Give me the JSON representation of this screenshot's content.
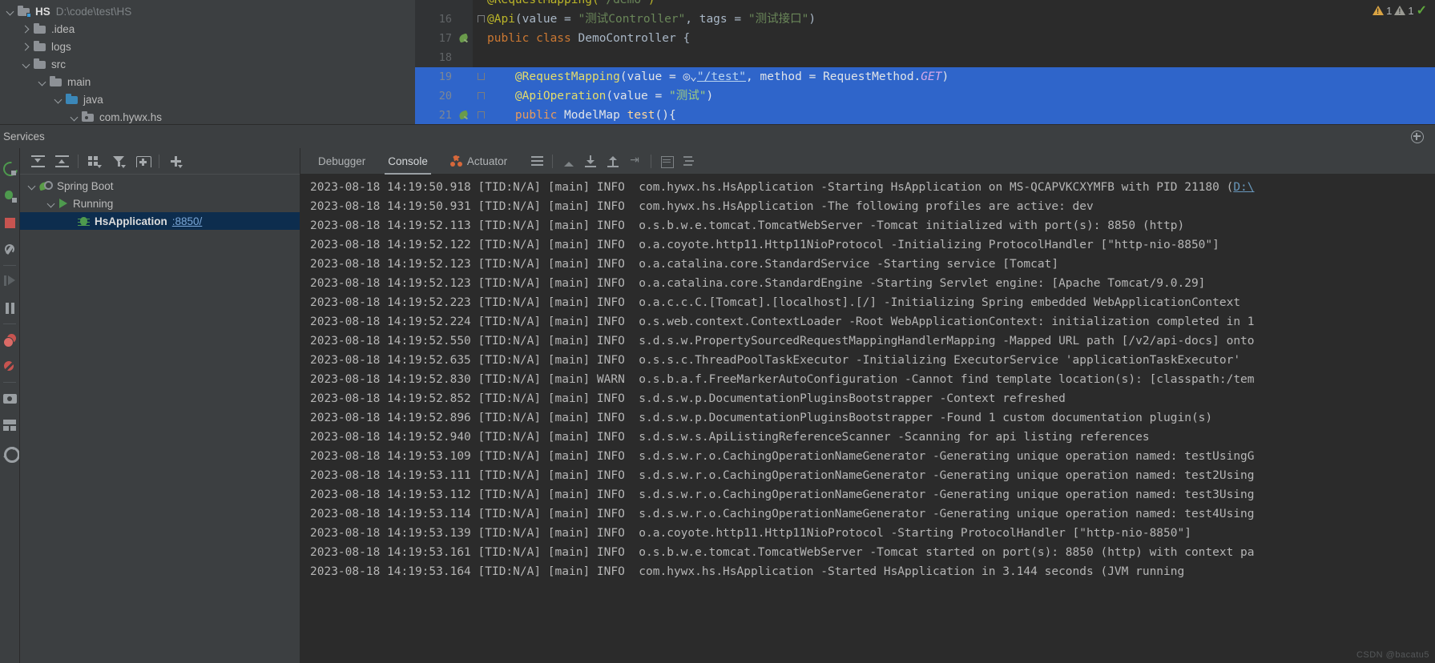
{
  "project_tree": [
    {
      "indent": 0,
      "chevron": "down",
      "icon": "project-folder-icon",
      "label": "HS",
      "bold": true,
      "path": "D:\\code\\test\\HS"
    },
    {
      "indent": 1,
      "chevron": "right",
      "icon": "folder-icon",
      "label": ".idea",
      "bold": false,
      "path": ""
    },
    {
      "indent": 1,
      "chevron": "right",
      "icon": "folder-icon",
      "label": "logs",
      "bold": false,
      "path": ""
    },
    {
      "indent": 1,
      "chevron": "down",
      "icon": "folder-icon",
      "label": "src",
      "bold": false,
      "path": ""
    },
    {
      "indent": 2,
      "chevron": "down",
      "icon": "folder-icon",
      "label": "main",
      "bold": false,
      "path": ""
    },
    {
      "indent": 3,
      "chevron": "down",
      "icon": "folder-blue-icon",
      "label": "java",
      "bold": false,
      "path": ""
    },
    {
      "indent": 4,
      "chevron": "down",
      "icon": "package-icon",
      "label": "com.hywx.hs",
      "bold": false,
      "path": ""
    }
  ],
  "editor": {
    "lines": [
      {
        "number": "",
        "fold": "none",
        "bean": false,
        "highlighted": false,
        "partial": true,
        "tokens": [
          {
            "t": "@RequestMapping(",
            "c": "tok-ann"
          },
          {
            "t": "\"/demo\"",
            "c": "tok-str"
          },
          {
            "t": ")",
            "c": "tok-ann"
          }
        ]
      },
      {
        "number": "16",
        "fold": "open",
        "bean": false,
        "highlighted": false,
        "partial": false,
        "tokens": [
          {
            "t": "@Api",
            "c": "tok-ann"
          },
          {
            "t": "(value = ",
            "c": "tok-ident"
          },
          {
            "t": "\"测试Controller\"",
            "c": "tok-str"
          },
          {
            "t": ", tags = ",
            "c": "tok-ident"
          },
          {
            "t": "\"测试接口\"",
            "c": "tok-str"
          },
          {
            "t": ")",
            "c": "tok-ident"
          }
        ]
      },
      {
        "number": "17",
        "fold": "none",
        "bean": true,
        "highlighted": false,
        "partial": false,
        "tokens": [
          {
            "t": "public class ",
            "c": "tok-kw"
          },
          {
            "t": "DemoController ",
            "c": "tok-cls"
          },
          {
            "t": "{",
            "c": "tok-ident"
          }
        ]
      },
      {
        "number": "18",
        "fold": "none",
        "bean": false,
        "highlighted": false,
        "partial": false,
        "tokens": []
      },
      {
        "number": "19",
        "fold": "close",
        "bean": false,
        "highlighted": true,
        "partial": false,
        "tokens": [
          {
            "t": "    @RequestMapping",
            "c": "tok-ann"
          },
          {
            "t": "(value = ",
            "c": "tok-ident"
          },
          {
            "t": "◎⌄",
            "c": "tok-ident"
          },
          {
            "t": "\"/test\"",
            "c": "tok-link"
          },
          {
            "t": ", method = ",
            "c": "tok-ident"
          },
          {
            "t": "RequestMethod.",
            "c": "tok-cls"
          },
          {
            "t": "GET",
            "c": "tok-static"
          },
          {
            "t": ")",
            "c": "tok-ident"
          }
        ]
      },
      {
        "number": "20",
        "fold": "open",
        "bean": false,
        "highlighted": true,
        "partial": false,
        "tokens": [
          {
            "t": "    @ApiOperation",
            "c": "tok-ann"
          },
          {
            "t": "(value = ",
            "c": "tok-ident"
          },
          {
            "t": "\"测试\"",
            "c": "tok-str"
          },
          {
            "t": ")",
            "c": "tok-ident"
          }
        ]
      },
      {
        "number": "21",
        "fold": "open",
        "bean": true,
        "highlighted": true,
        "partial": false,
        "tokens": [
          {
            "t": "    public ",
            "c": "tok-kw"
          },
          {
            "t": "ModelMap ",
            "c": "tok-cls"
          },
          {
            "t": "test",
            "c": "tok-method"
          },
          {
            "t": "(){",
            "c": "tok-ident"
          }
        ]
      }
    ],
    "inspections": {
      "warning_count": "1",
      "weak_warning_count": "1",
      "ok_count": "2"
    }
  },
  "services": {
    "panel_title": "Services",
    "toolbar": [
      {
        "name": "rerun-icon",
        "label": "Rerun"
      },
      {
        "name": "expand-all-icon",
        "label": "Expand All"
      },
      {
        "name": "collapse-all-icon",
        "label": "Collapse All"
      },
      {
        "name": "group-icon",
        "label": "Group"
      },
      {
        "name": "filter-icon",
        "label": "Filter"
      },
      {
        "name": "add-tab-icon",
        "label": "Add Tab"
      },
      {
        "name": "add-icon",
        "label": "Add Service"
      }
    ],
    "tree": [
      {
        "indent": 0,
        "chevron": "down",
        "icon": "spring-boot-icon",
        "label": "Spring Boot",
        "port": "",
        "selected": false,
        "bold": false
      },
      {
        "indent": 1,
        "chevron": "down",
        "icon": "run-icon",
        "label": "Running",
        "port": "",
        "selected": false,
        "bold": false
      },
      {
        "indent": 2,
        "chevron": "none",
        "icon": "debug-bug-icon",
        "label": "HsApplication",
        "port": ":8850/",
        "selected": true,
        "bold": true
      }
    ]
  },
  "console": {
    "tabs": [
      {
        "label": "Debugger",
        "active": false,
        "icon": ""
      },
      {
        "label": "Console",
        "active": true,
        "icon": ""
      },
      {
        "label": "Actuator",
        "active": false,
        "icon": "actuator-icon"
      }
    ],
    "tools": [
      {
        "name": "soft-wrap-icon"
      },
      {
        "name": "scroll-up-icon"
      },
      {
        "name": "scroll-to-end-icon"
      },
      {
        "name": "scroll-to-top-icon"
      },
      {
        "name": "wrap-text-icon"
      },
      {
        "name": "print-icon"
      },
      {
        "name": "align-icon"
      }
    ],
    "watermark": "CSDN @bacatu5",
    "log_lines": [
      {
        "text": "2023-08-18 14:19:50.918 [TID:N/A] [main] INFO  com.hywx.hs.HsApplication -Starting HsApplication on MS-QCAPVKCXYMFB with PID 21180 (",
        "link": "D:\\"
      },
      {
        "text": "2023-08-18 14:19:50.931 [TID:N/A] [main] INFO  com.hywx.hs.HsApplication -The following profiles are active: dev",
        "link": ""
      },
      {
        "text": "2023-08-18 14:19:52.113 [TID:N/A] [main] INFO  o.s.b.w.e.tomcat.TomcatWebServer -Tomcat initialized with port(s): 8850 (http)",
        "link": ""
      },
      {
        "text": "2023-08-18 14:19:52.122 [TID:N/A] [main] INFO  o.a.coyote.http11.Http11NioProtocol -Initializing ProtocolHandler [\"http-nio-8850\"]",
        "link": ""
      },
      {
        "text": "2023-08-18 14:19:52.123 [TID:N/A] [main] INFO  o.a.catalina.core.StandardService -Starting service [Tomcat]",
        "link": ""
      },
      {
        "text": "2023-08-18 14:19:52.123 [TID:N/A] [main] INFO  o.a.catalina.core.StandardEngine -Starting Servlet engine: [Apache Tomcat/9.0.29]",
        "link": ""
      },
      {
        "text": "2023-08-18 14:19:52.223 [TID:N/A] [main] INFO  o.a.c.c.C.[Tomcat].[localhost].[/] -Initializing Spring embedded WebApplicationContext",
        "link": ""
      },
      {
        "text": "2023-08-18 14:19:52.224 [TID:N/A] [main] INFO  o.s.web.context.ContextLoader -Root WebApplicationContext: initialization completed in 1",
        "link": ""
      },
      {
        "text": "2023-08-18 14:19:52.550 [TID:N/A] [main] INFO  s.d.s.w.PropertySourcedRequestMappingHandlerMapping -Mapped URL path [/v2/api-docs] onto",
        "link": ""
      },
      {
        "text": "2023-08-18 14:19:52.635 [TID:N/A] [main] INFO  o.s.s.c.ThreadPoolTaskExecutor -Initializing ExecutorService 'applicationTaskExecutor'",
        "link": ""
      },
      {
        "text": "2023-08-18 14:19:52.830 [TID:N/A] [main] WARN  o.s.b.a.f.FreeMarkerAutoConfiguration -Cannot find template location(s): [classpath:/tem",
        "link": ""
      },
      {
        "text": "2023-08-18 14:19:52.852 [TID:N/A] [main] INFO  s.d.s.w.p.DocumentationPluginsBootstrapper -Context refreshed",
        "link": ""
      },
      {
        "text": "2023-08-18 14:19:52.896 [TID:N/A] [main] INFO  s.d.s.w.p.DocumentationPluginsBootstrapper -Found 1 custom documentation plugin(s)",
        "link": ""
      },
      {
        "text": "2023-08-18 14:19:52.940 [TID:N/A] [main] INFO  s.d.s.w.s.ApiListingReferenceScanner -Scanning for api listing references",
        "link": ""
      },
      {
        "text": "2023-08-18 14:19:53.109 [TID:N/A] [main] INFO  s.d.s.w.r.o.CachingOperationNameGenerator -Generating unique operation named: testUsingG",
        "link": ""
      },
      {
        "text": "2023-08-18 14:19:53.111 [TID:N/A] [main] INFO  s.d.s.w.r.o.CachingOperationNameGenerator -Generating unique operation named: test2Using",
        "link": ""
      },
      {
        "text": "2023-08-18 14:19:53.112 [TID:N/A] [main] INFO  s.d.s.w.r.o.CachingOperationNameGenerator -Generating unique operation named: test3Using",
        "link": ""
      },
      {
        "text": "2023-08-18 14:19:53.114 [TID:N/A] [main] INFO  s.d.s.w.r.o.CachingOperationNameGenerator -Generating unique operation named: test4Using",
        "link": ""
      },
      {
        "text": "2023-08-18 14:19:53.139 [TID:N/A] [main] INFO  o.a.coyote.http11.Http11NioProtocol -Starting ProtocolHandler [\"http-nio-8850\"]",
        "link": ""
      },
      {
        "text": "2023-08-18 14:19:53.161 [TID:N/A] [main] INFO  o.s.b.w.e.tomcat.TomcatWebServer -Tomcat started on port(s): 8850 (http) with context pa",
        "link": ""
      },
      {
        "text": "2023-08-18 14:19:53.164 [TID:N/A] [main] INFO  com.hywx.hs.HsApplication -Started HsApplication in 3.144 seconds (JVM running",
        "link": ""
      }
    ]
  },
  "left_strip_icons": [
    {
      "name": "rerun-icon"
    },
    {
      "name": "debug-icon"
    },
    {
      "name": "stop-icon"
    },
    {
      "name": "wrench-icon"
    },
    {
      "name": "resume-program-icon"
    },
    {
      "name": "pause-program-icon"
    },
    {
      "name": "view-breakpoints-icon"
    },
    {
      "name": "mute-breakpoints-icon"
    },
    {
      "name": "camera-icon"
    },
    {
      "name": "layout-icon"
    },
    {
      "name": "settings-icon"
    }
  ],
  "colors": {
    "panel_bg": "#3c3f41",
    "editor_bg": "#2b2b2b",
    "selection_blue": "#2f65ca",
    "tree_selection": "#0d2d4e",
    "accent_green": "#4e9a4e",
    "accent_orange": "#d6683b",
    "link_blue": "#6897bb"
  }
}
